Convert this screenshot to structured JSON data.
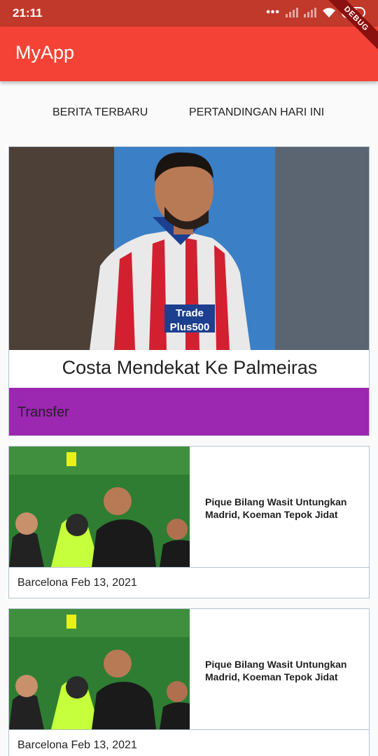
{
  "status_bar": {
    "time": "21:11",
    "battery": "35"
  },
  "app_bar": {
    "title": "MyApp",
    "debug_label": "DEBUG"
  },
  "tabs": [
    {
      "label": "BERITA TERBARU"
    },
    {
      "label": "PERTANDINGAN HARI INI"
    }
  ],
  "hero": {
    "title": "Costa Mendekat Ke Palmeiras",
    "category": "Transfer",
    "image_caption": "Trade Plus500",
    "category_color": "#9c27b0"
  },
  "news": [
    {
      "title": "Pique Bilang Wasit Untungkan Madrid, Koeman Tepok Jidat",
      "meta": "Barcelona Feb 13, 2021"
    },
    {
      "title": "Pique Bilang Wasit Untungkan Madrid, Koeman Tepok Jidat",
      "meta": "Barcelona Feb 13, 2021"
    }
  ],
  "colors": {
    "status_bar": "#c0392b",
    "app_bar": "#f44336",
    "accent": "#9c27b0"
  }
}
